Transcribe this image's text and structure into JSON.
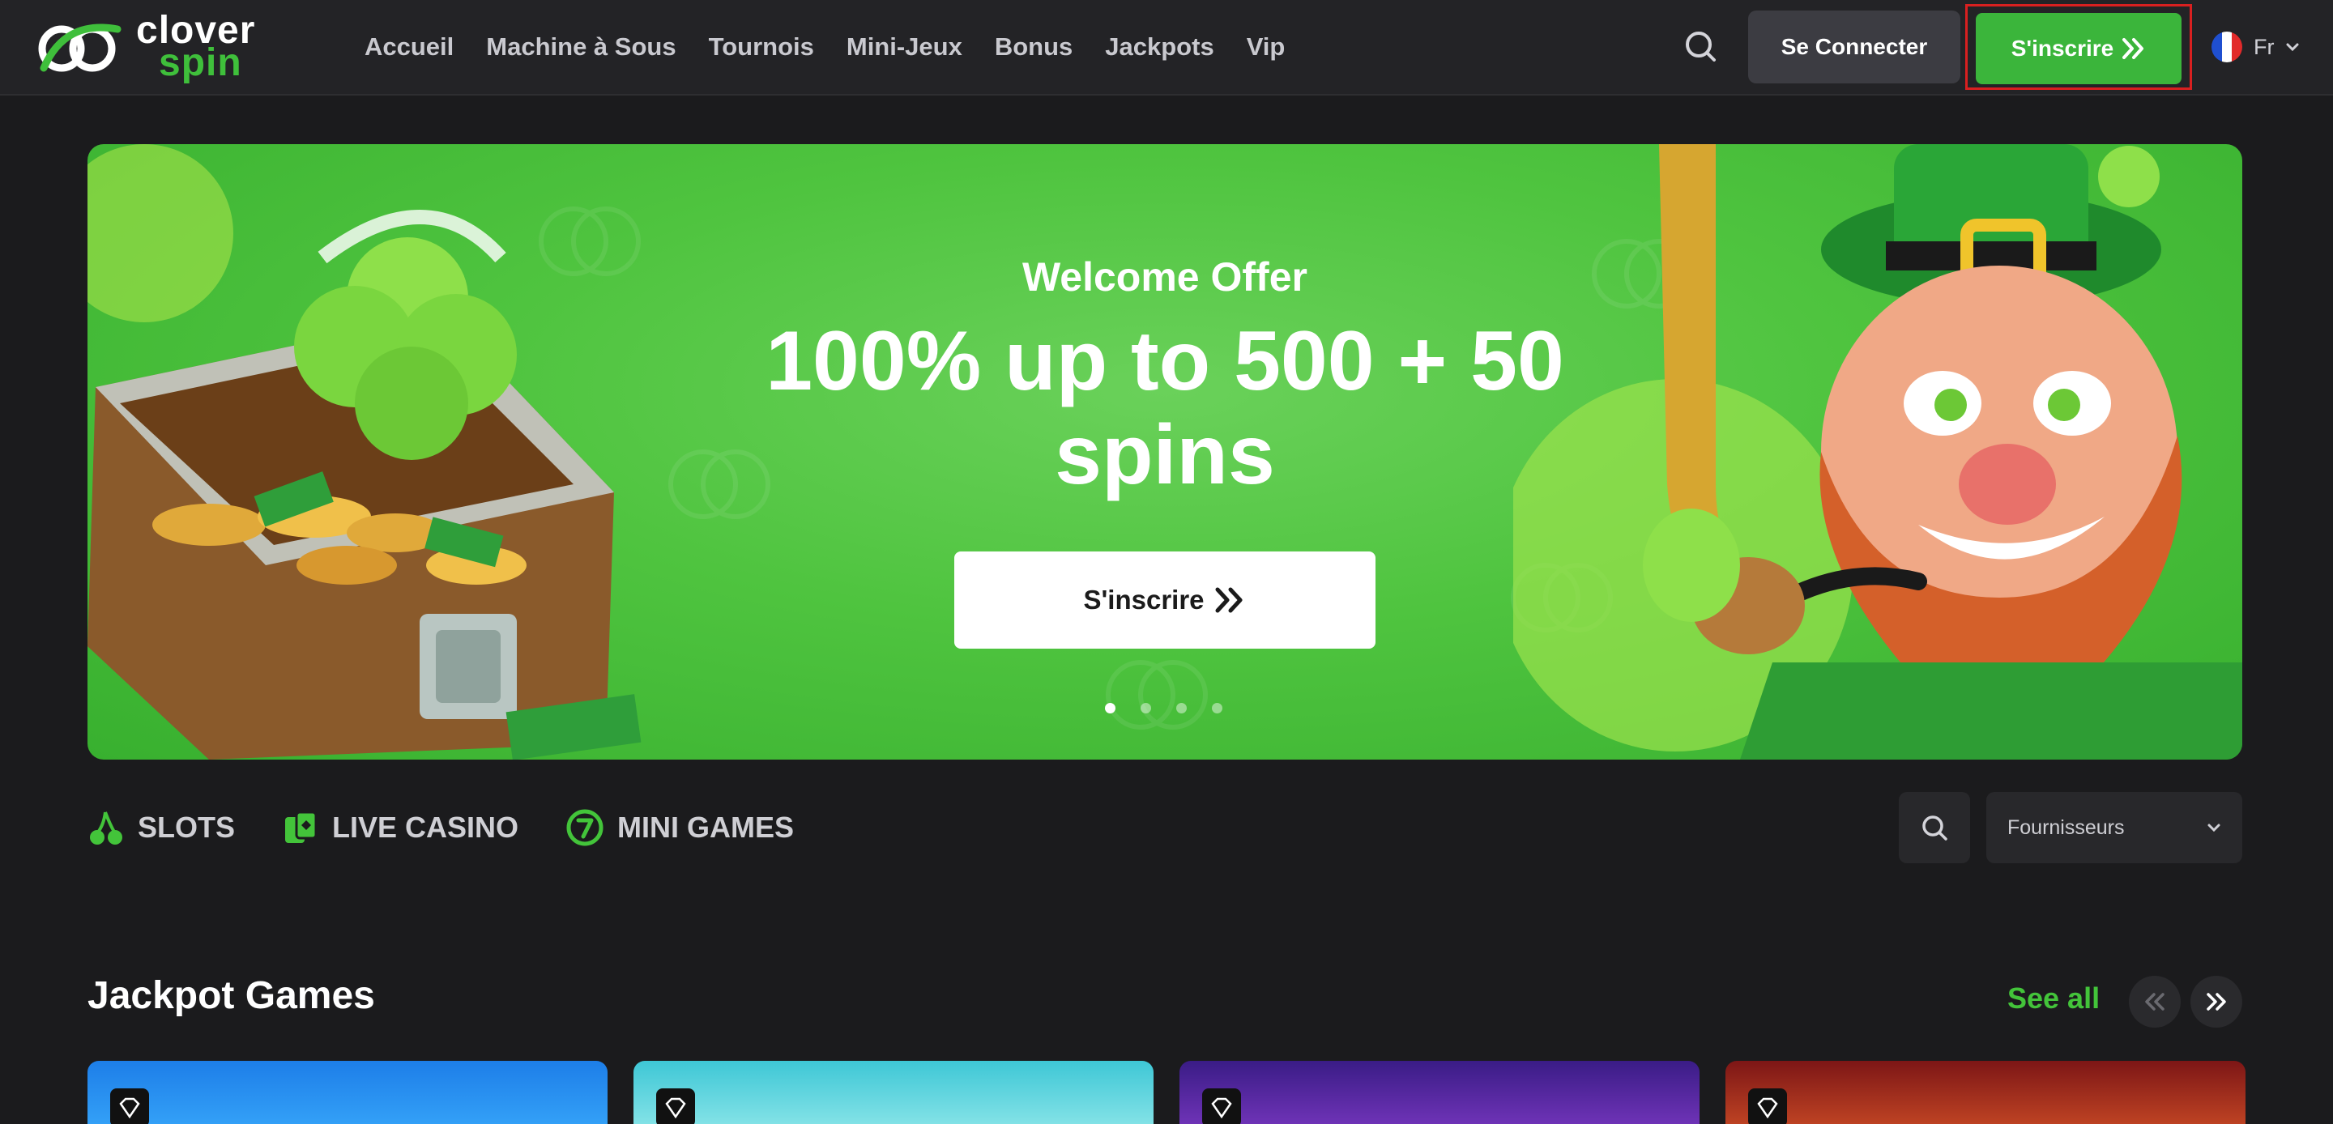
{
  "header": {
    "logo": {
      "line1": "clover",
      "line2": "spin"
    },
    "nav": [
      "Accueil",
      "Machine à Sous",
      "Tournois",
      "Mini-Jeux",
      "Bonus",
      "Jackpots",
      "Vip"
    ],
    "login_label": "Se Connecter",
    "signup_label": "S'inscrire",
    "language": "Fr"
  },
  "hero": {
    "subtitle": "Welcome Offer",
    "title": "100% up to 500 + 50 spins",
    "cta_label": "S'inscrire",
    "slides": 4,
    "active_slide": 1
  },
  "categories": [
    {
      "label": "SLOTS",
      "icon": "cherry-icon"
    },
    {
      "label": "LIVE CASINO",
      "icon": "cards-icon"
    },
    {
      "label": "MINI GAMES",
      "icon": "seven-coin-icon"
    }
  ],
  "filters": {
    "providers_label": "Fournisseurs"
  },
  "jackpot": {
    "title": "Jackpot Games",
    "see_all": "See all",
    "cards": [
      {
        "colors": [
          "#1d7ee8",
          "#3fb2ff"
        ]
      },
      {
        "colors": [
          "#3ec7d6",
          "#a7f0ef"
        ]
      },
      {
        "colors": [
          "#3a1c86",
          "#8a3fd0"
        ]
      },
      {
        "colors": [
          "#7d1616",
          "#e05a2a"
        ]
      }
    ]
  },
  "colors": {
    "accent_green": "#3bb53b",
    "background": "#1b1b1d",
    "header": "#232326",
    "highlight_border": "#d92020"
  }
}
